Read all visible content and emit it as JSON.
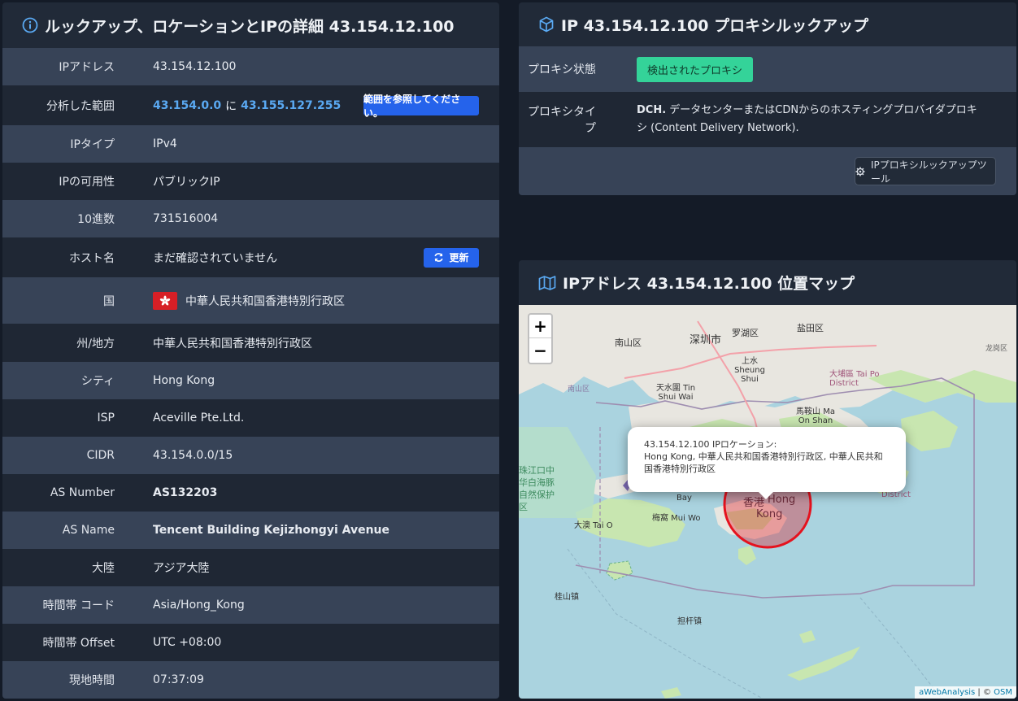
{
  "details": {
    "title": "ルックアップ、ロケーションとIPの詳細 43.154.12.100",
    "rows": [
      {
        "label": "IPアドレス",
        "value": "43.154.12.100"
      },
      {
        "label": "分析した範囲",
        "range_start": "43.154.0.0",
        "range_mid": "に",
        "range_end": "43.155.127.255",
        "button": "範囲を参照してください。"
      },
      {
        "label": "IPタイプ",
        "value": "IPv4"
      },
      {
        "label": "IPの可用性",
        "value": "パブリックIP"
      },
      {
        "label": "10進数",
        "value": "731516004"
      },
      {
        "label": "ホスト名",
        "value": "まだ確認されていません",
        "button": "更新"
      },
      {
        "label": "国",
        "value": "中華人民共和国香港特別行政区"
      },
      {
        "label": "州/地方",
        "value": "中華人民共和国香港特別行政区"
      },
      {
        "label": "シティ",
        "value": "Hong Kong"
      },
      {
        "label": "ISP",
        "value": "Aceville Pte.Ltd."
      },
      {
        "label": "CIDR",
        "value": "43.154.0.0/15"
      },
      {
        "label": "AS Number",
        "value": "AS132203"
      },
      {
        "label": "AS Name",
        "value": "Tencent Building Kejizhongyi Avenue"
      },
      {
        "label": "大陸",
        "value": "アジア大陸"
      },
      {
        "label": "時間帯 コード",
        "value": "Asia/Hong_Kong"
      },
      {
        "label": "時間帯 Offset",
        "value": "UTC +08:00"
      },
      {
        "label": "現地時間",
        "value": "07:37:09"
      }
    ]
  },
  "proxy": {
    "title": "IP 43.154.12.100 プロキシルックアップ",
    "status_label": "プロキシ状態",
    "status_value": "検出されたプロキシ",
    "type_label": "プロキシタイプ",
    "type_bold": "DCH.",
    "type_text": " データセンターまたはCDNからのホスティングプロバイダプロキシ (Content Delivery Network).",
    "tool_button": "IPプロキシルックアップツール"
  },
  "map": {
    "title": "IPアドレス 43.154.12.100 位置マップ",
    "zoom_in": "+",
    "zoom_out": "−",
    "popup_line1": "43.154.12.100 IPロケーション:",
    "popup_line2": "Hong Kong, 中華人民共和国香港特別行政区, 中華人民共和国香港特別行政区",
    "attribution_site": "aWebAnalysis",
    "attribution_sep": " | © ",
    "attribution_osm": "OSM",
    "labels": {
      "nanshan": "南山区",
      "shenzhen": "深圳市",
      "luohu": "罗湖区",
      "yantian": "盐田区",
      "longgang": "龙岗区",
      "sheung_shui": "上水 Sheung Shui",
      "tai_po": "大埔區 Tai Po District",
      "tin_shui_wai": "天水圍 Tin Shui Wai",
      "ma_on_shan": "馬鞍山 Ma On Shan",
      "nanshan_district": "南山区",
      "zhujiangkou": "珠江口中华白海豚自然保护区",
      "tai_o": "大澳 Tai O",
      "mui_wo": "梅窩 Mui Wo",
      "bay": "Bay",
      "hk_zh": "香港",
      "hk_en": "Hong Kong",
      "district": "District",
      "guishan": "桂山镇",
      "dangan": "担杆镇"
    }
  },
  "colors": {
    "panel": "#212a38",
    "row_odd": "#374357",
    "row_even": "#1f2734",
    "link": "#5aa9f2",
    "button_blue": "#2563eb",
    "badge_green": "#34d399",
    "water": "#aad3df",
    "land": "#e8e6e0",
    "park": "#c8e6b0",
    "circle": "#e5121e"
  }
}
